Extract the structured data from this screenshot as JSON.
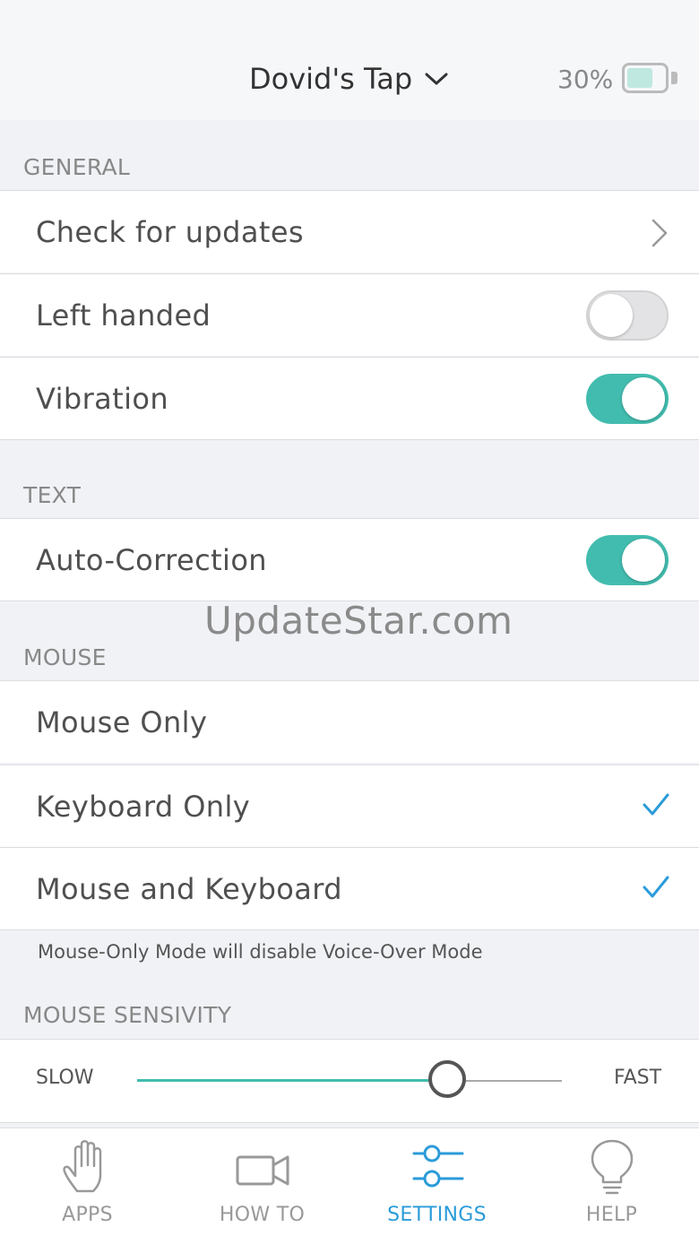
{
  "header": {
    "device_name": "Dovid's Tap",
    "battery_percent_text": "30%",
    "battery_level": 0.3
  },
  "sections": {
    "general": "GENERAL",
    "text": "TEXT",
    "mouse": "MOUSE",
    "mouse_sensitivity": "MOUSE SENSIVITY"
  },
  "general": {
    "check_updates": "Check for updates",
    "left_handed": "Left  handed",
    "left_handed_on": false,
    "vibration": "Vibration",
    "vibration_on": true
  },
  "text": {
    "auto_correction": "Auto-Correction",
    "auto_correction_on": true
  },
  "mouse": {
    "mouse_only": "Mouse Only",
    "mouse_only_checked": false,
    "keyboard_only": "Keyboard Only",
    "keyboard_only_checked": true,
    "mouse_and_keyboard": "Mouse and Keyboard",
    "mouse_and_keyboard_checked": true,
    "note": "Mouse-Only Mode will disable Voice-Over Mode"
  },
  "sensitivity": {
    "slow": "SLOW",
    "fast": "FAST",
    "value": 0.73
  },
  "watermark": "UpdateStar.com",
  "tabs": [
    {
      "label": "APPS",
      "icon": "hand-icon",
      "active": false
    },
    {
      "label": "HOW TO",
      "icon": "video-camera-icon",
      "active": false
    },
    {
      "label": "SETTINGS",
      "icon": "sliders-icon",
      "active": true
    },
    {
      "label": "HELP",
      "icon": "lightbulb-icon",
      "active": false
    }
  ],
  "colors": {
    "accent_teal": "#42bcae",
    "accent_blue": "#2b9bd9",
    "background": "#f1f2f6"
  }
}
